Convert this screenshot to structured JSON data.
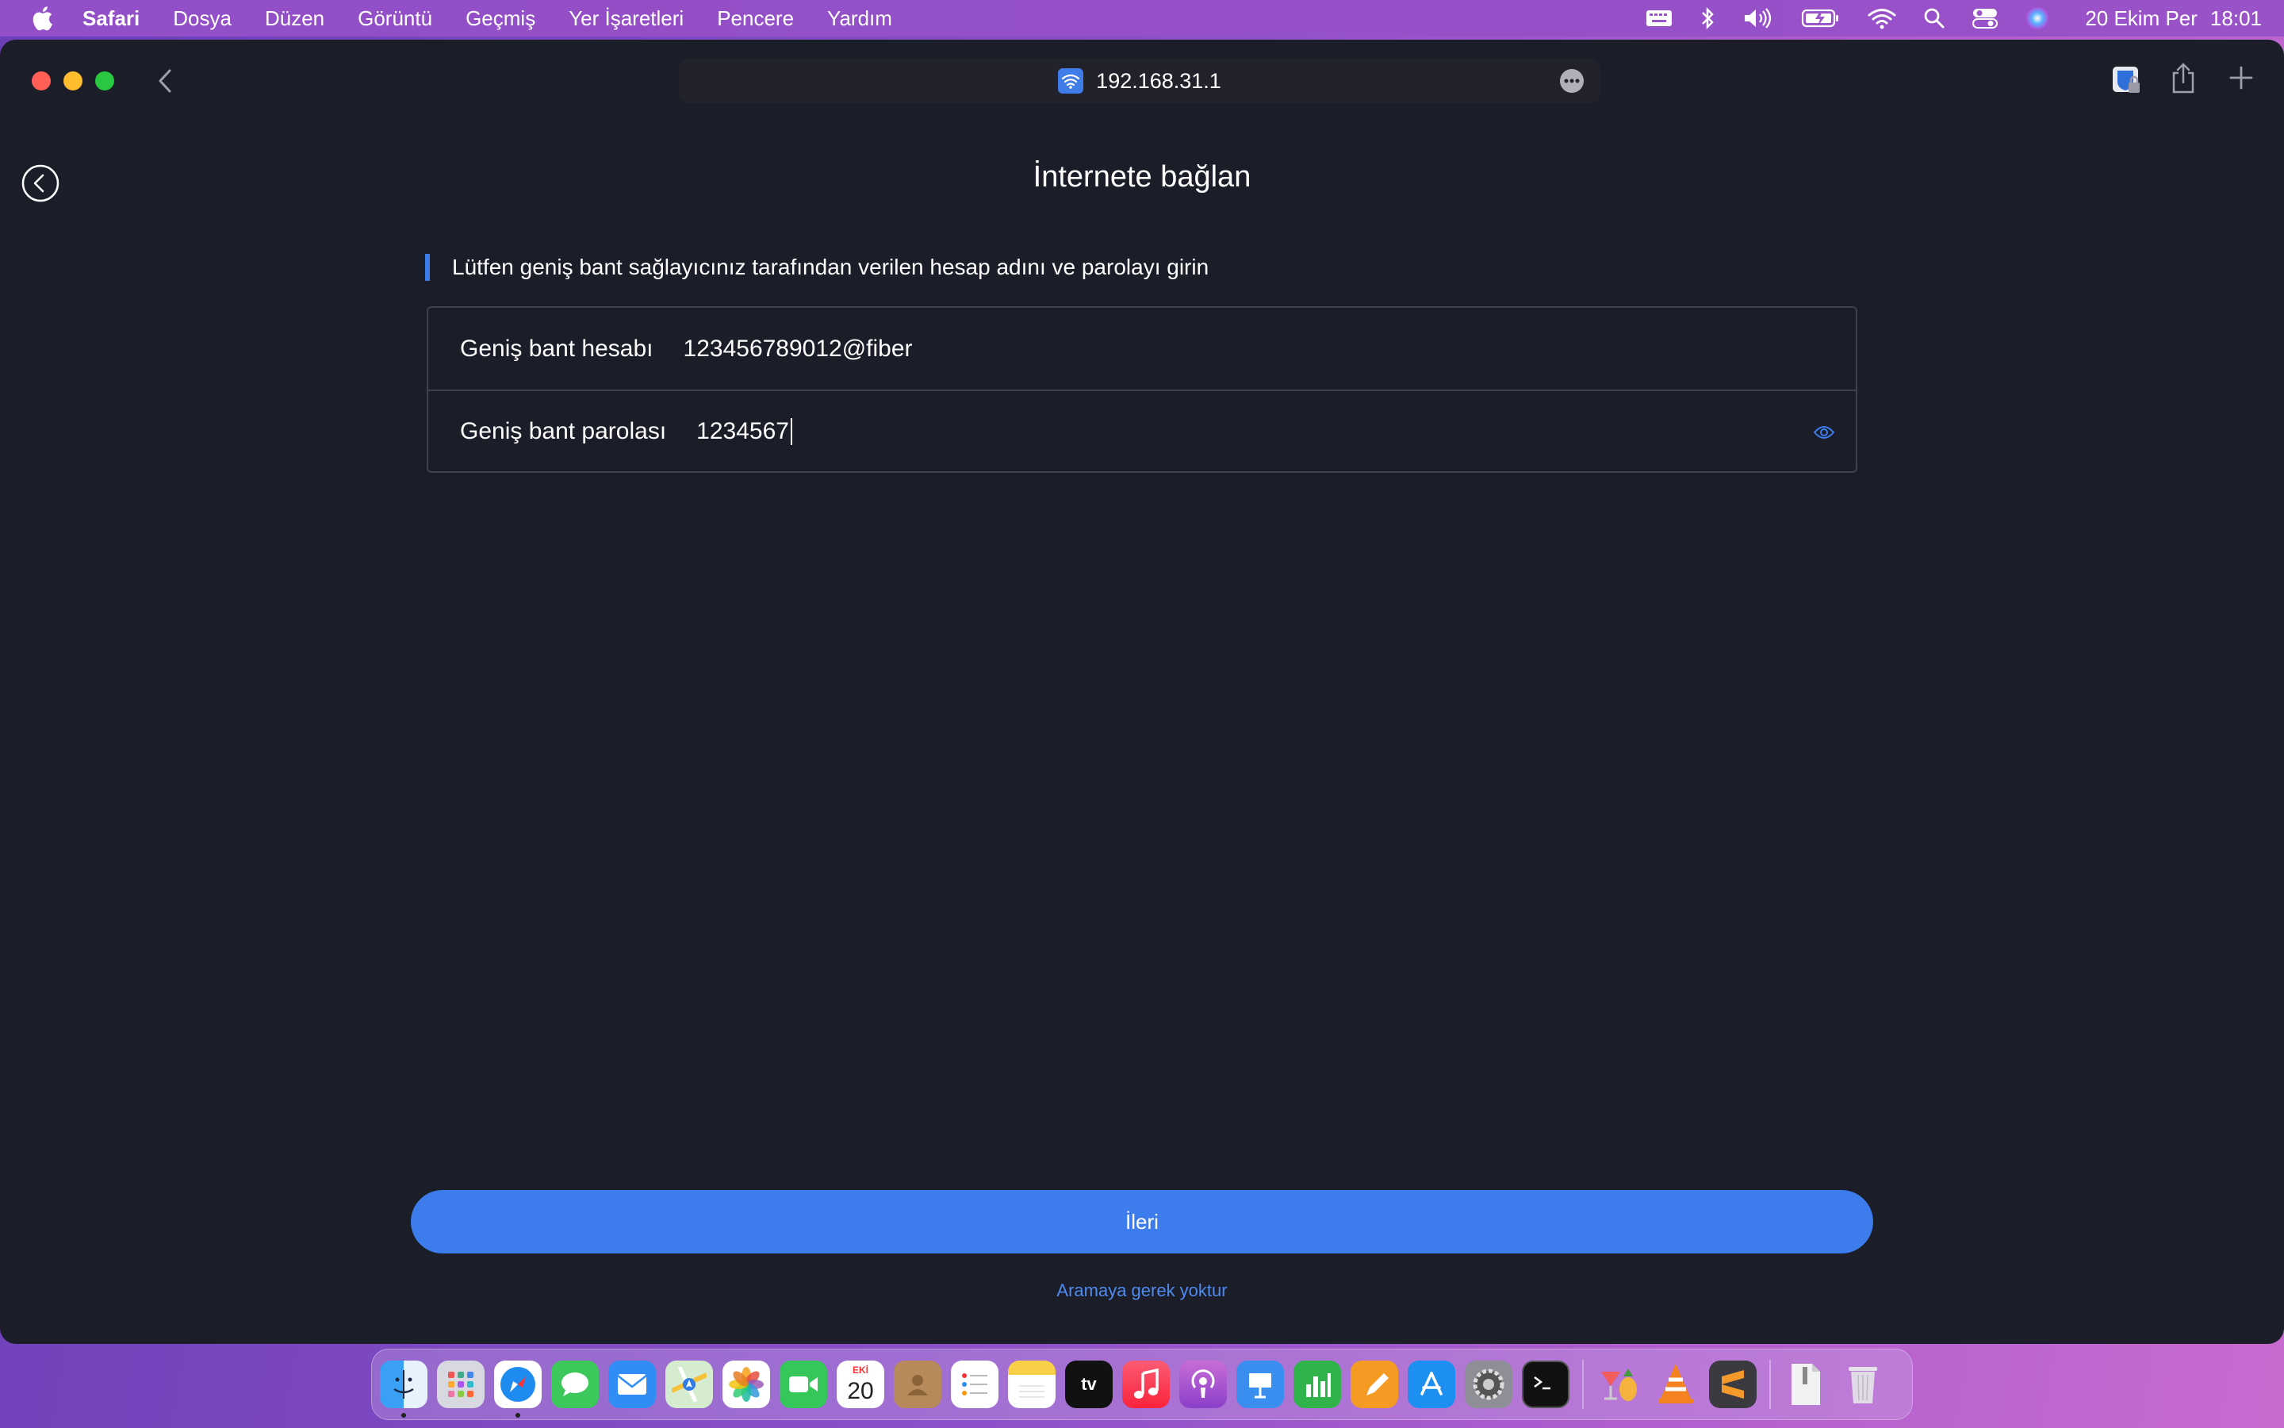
{
  "menubar": {
    "app_name": "Safari",
    "items": [
      "Dosya",
      "Düzen",
      "Görüntü",
      "Geçmiş",
      "Yer İşaretleri",
      "Pencere",
      "Yardım"
    ],
    "status_icons": [
      "keyboard-icon",
      "bluetooth-icon",
      "volume-icon",
      "battery-icon",
      "wifi-icon",
      "spotlight-icon",
      "control-center-icon",
      "siri-icon"
    ],
    "date": "20 Ekim Per",
    "time": "18:01"
  },
  "browser": {
    "url": "192.168.31.1"
  },
  "page": {
    "title": "İnternete bağlan",
    "instruction": "Lütfen geniş bant sağlayıcınız tarafından verilen hesap adını ve parolayı girin",
    "account_label": "Geniş bant hesabı",
    "account_value": "123456789012@fiber",
    "password_label": "Geniş bant parolası",
    "password_value": "1234567",
    "next_label": "İleri",
    "skip_label": "Aramaya gerek yoktur"
  },
  "dock": {
    "calendar_month": "EKİ",
    "calendar_day": "20",
    "tv_label": "tv",
    "apps": [
      "finder",
      "launchpad",
      "safari",
      "messages",
      "mail",
      "maps",
      "photos",
      "facetime",
      "calendar",
      "contacts",
      "reminders",
      "notes",
      "tv",
      "music",
      "podcasts",
      "keynote",
      "numbers",
      "pages",
      "app-store",
      "system-preferences",
      "terminal",
      "fruit-app",
      "vlc",
      "sublime-text",
      "archive-file",
      "trash"
    ]
  },
  "colors": {
    "accent": "#3d7cec",
    "window_bg": "#1b1d28",
    "link": "#4f8bf0"
  }
}
